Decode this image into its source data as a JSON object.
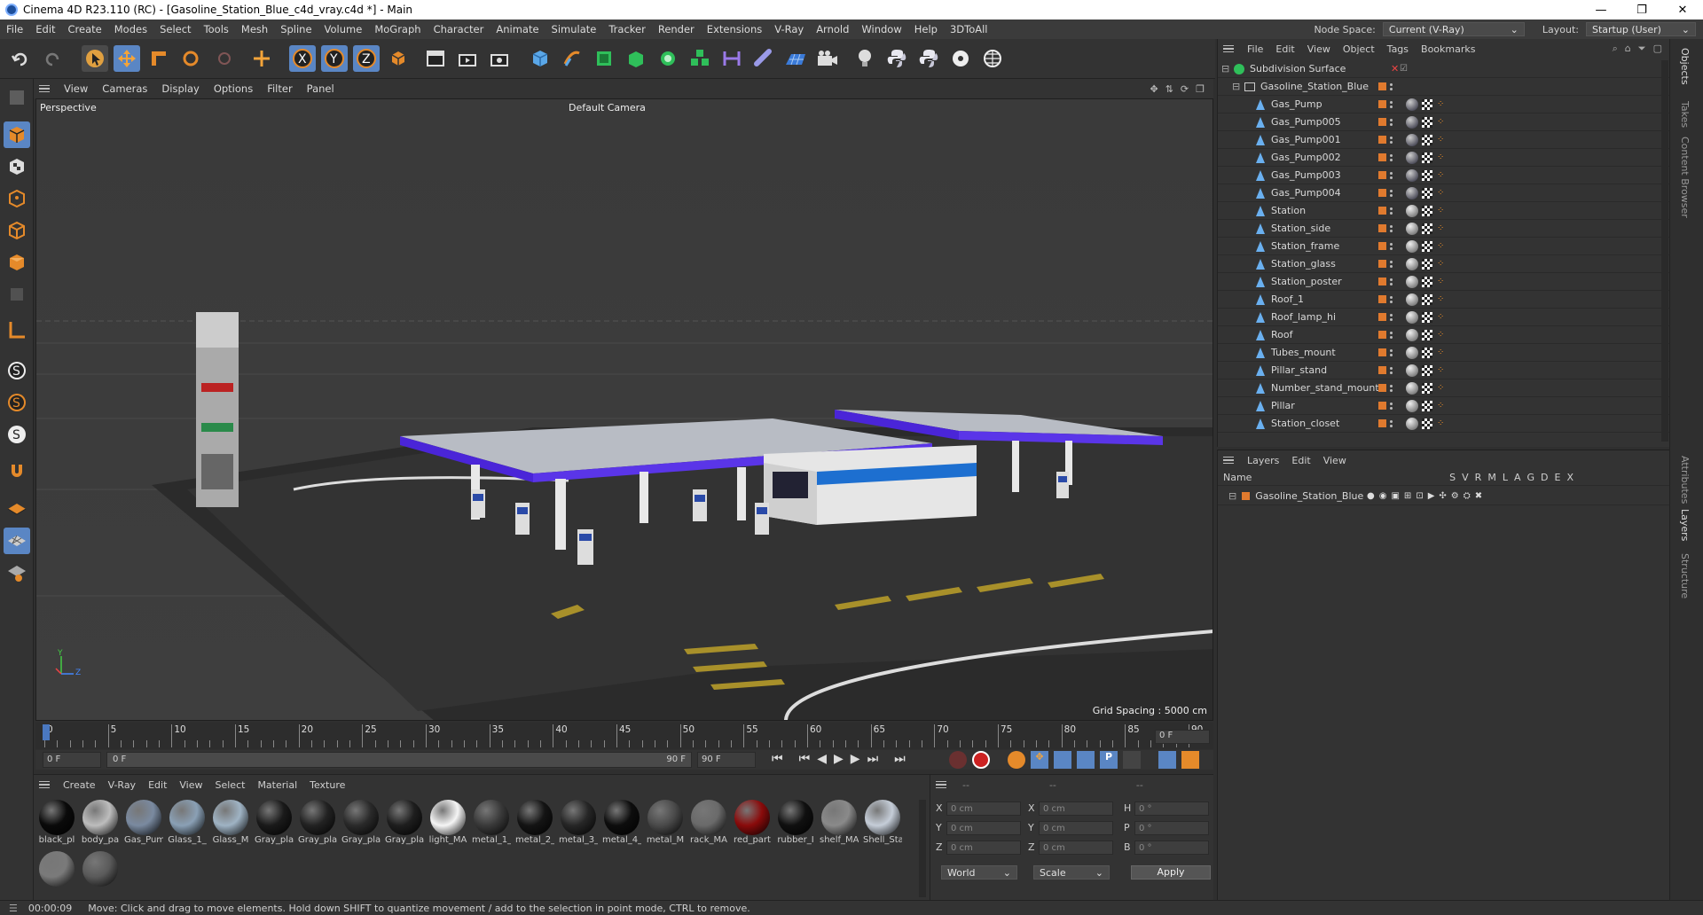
{
  "window": {
    "title": "Cinema 4D R23.110 (RC) - [Gasoline_Station_Blue_c4d_vray.c4d *] - Main",
    "min": "—",
    "max": "❐",
    "close": "✕"
  },
  "menubar": {
    "items": [
      "File",
      "Edit",
      "Create",
      "Modes",
      "Select",
      "Tools",
      "Mesh",
      "Spline",
      "Volume",
      "MoGraph",
      "Character",
      "Animate",
      "Simulate",
      "Tracker",
      "Render",
      "Extensions",
      "V-Ray",
      "Arnold",
      "Window",
      "Help",
      "3DToAll"
    ],
    "node_space_label": "Node Space:",
    "node_space_value": "Current (V-Ray)",
    "layout_label": "Layout:",
    "layout_value": "Startup (User)"
  },
  "viewport": {
    "menu": [
      "View",
      "Cameras",
      "Display",
      "Options",
      "Filter",
      "Panel"
    ],
    "name": "Perspective",
    "camera": "Default Camera",
    "grid_spacing": "Grid Spacing : 5000 cm",
    "axis_y": "Y",
    "axis_z": "Z"
  },
  "timeline": {
    "labels": [
      "0",
      "5",
      "10",
      "15",
      "20",
      "25",
      "30",
      "35",
      "40",
      "45",
      "50",
      "55",
      "60",
      "65",
      "70",
      "75",
      "80",
      "85",
      "90"
    ],
    "current_frame": "0 F",
    "start_field": "0 F",
    "range_start": "0 F",
    "range_end": "90 F",
    "end_field": "90 F"
  },
  "materials": {
    "menu": [
      "Create",
      "V-Ray",
      "Edit",
      "View",
      "Select",
      "Material",
      "Texture"
    ],
    "items": [
      {
        "label": "black_pl",
        "color": "#0a0a0a"
      },
      {
        "label": "body_pa",
        "color": "#bdbdbd"
      },
      {
        "label": "Gas_Pum",
        "color": "#7a8aa0"
      },
      {
        "label": "Glass_1_",
        "color": "#8aa0b5"
      },
      {
        "label": "Glass_M",
        "color": "#9fb3c4"
      },
      {
        "label": "Gray_pla",
        "color": "#1a1a1a"
      },
      {
        "label": "Gray_pla",
        "color": "#222222"
      },
      {
        "label": "Gray_pla",
        "color": "#2a2a2a"
      },
      {
        "label": "Gray_pla",
        "color": "#1e1e1e"
      },
      {
        "label": "light_MA",
        "color": "#f5f5f5"
      },
      {
        "label": "metal_1_",
        "color": "#3a3a3a"
      },
      {
        "label": "metal_2_",
        "color": "#141414"
      },
      {
        "label": "metal_3_",
        "color": "#262626"
      },
      {
        "label": "metal_4_",
        "color": "#0d0d0d"
      },
      {
        "label": "metal_M",
        "color": "#4a4a4a"
      },
      {
        "label": "rack_MA",
        "color": "#6a6a6a"
      },
      {
        "label": "red_part",
        "color": "#8a0b0b"
      },
      {
        "label": "rubber_I",
        "color": "#101010"
      },
      {
        "label": "shelf_MA",
        "color": "#8a8a8a"
      },
      {
        "label": "Shell_Sta",
        "color": "#c5cdd8"
      },
      {
        "label": "",
        "color": "#7a7a7a"
      },
      {
        "label": "",
        "color": "#5a5a5a"
      }
    ]
  },
  "coords": {
    "header": [
      "--",
      "--",
      "--"
    ],
    "rows": [
      {
        "a": "X",
        "av": "0 cm",
        "b": "X",
        "bv": "0 cm",
        "c": "H",
        "cv": "0 °"
      },
      {
        "a": "Y",
        "av": "0 cm",
        "b": "Y",
        "bv": "0 cm",
        "c": "P",
        "cv": "0 °"
      },
      {
        "a": "Z",
        "av": "0 cm",
        "b": "Z",
        "bv": "0 cm",
        "c": "B",
        "cv": "0 °"
      }
    ],
    "world": "World",
    "scale": "Scale",
    "apply": "Apply"
  },
  "objects": {
    "menu": [
      "File",
      "Edit",
      "View",
      "Object",
      "Tags",
      "Bookmarks"
    ],
    "root": "Subdivision Surface",
    "group": "Gasoline_Station_Blue",
    "items": [
      "Gas_Pump",
      "Gas_Pump005",
      "Gas_Pump001",
      "Gas_Pump002",
      "Gas_Pump003",
      "Gas_Pump004",
      "Station",
      "Station_side",
      "Station_frame",
      "Station_glass",
      "Station_poster",
      "Roof_1",
      "Roof_lamp_hi",
      "Roof",
      "Tubes_mount",
      "Pillar_stand",
      "Number_stand_mount",
      "Pillar",
      "Station_closet"
    ]
  },
  "layers": {
    "menu": [
      "Layers",
      "Edit",
      "View"
    ],
    "name_header": "Name",
    "cols": [
      "S",
      "V",
      "R",
      "M",
      "L",
      "A",
      "G",
      "D",
      "E",
      "X"
    ],
    "items": [
      "Gasoline_Station_Blue"
    ]
  },
  "rightstrip": [
    "Objects",
    "Takes",
    "Content Browser",
    "Attributes",
    "Layers",
    "Structure"
  ],
  "status": {
    "time": "00:00:09",
    "message": "Move: Click and drag to move elements. Hold down SHIFT to quantize movement / add to the selection in point mode, CTRL to remove."
  },
  "colors": {
    "accent_orange": "#e07a2e",
    "canopy_blue": "#4a25d8",
    "panel_bg": "#333333"
  }
}
